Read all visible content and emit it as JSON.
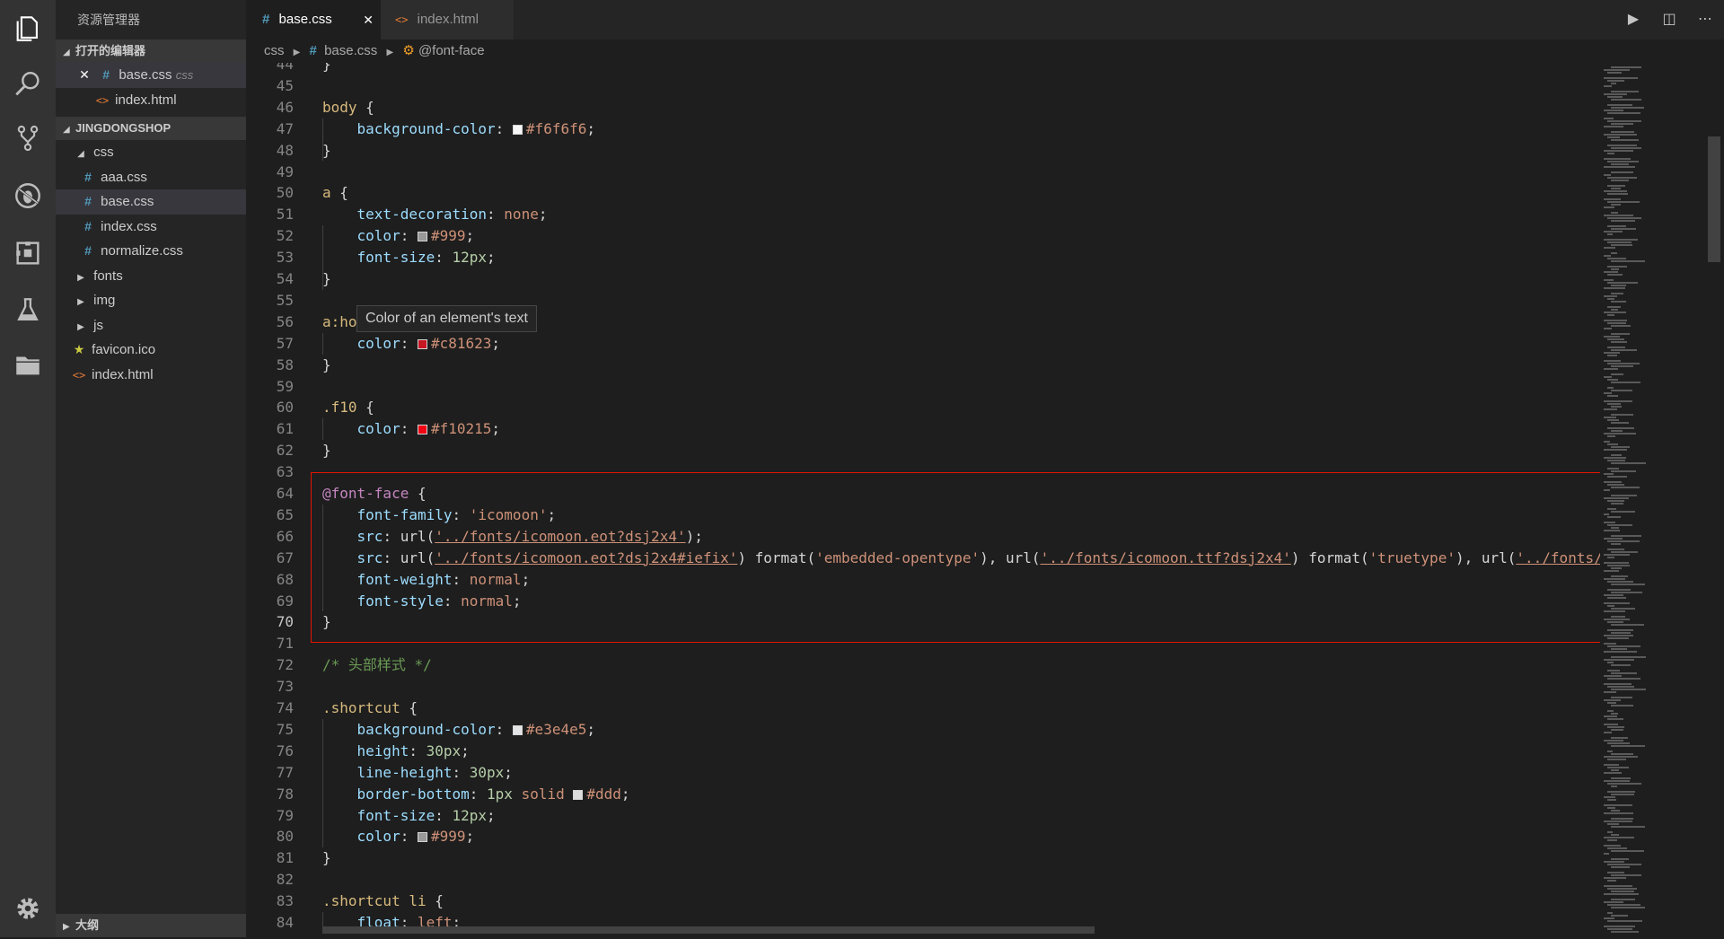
{
  "activity_bar": {
    "icons": [
      "files-icon",
      "search-icon",
      "source-control-icon",
      "debug-icon",
      "extensions-icon",
      "test-icon",
      "folder-icon",
      "settings-gear-icon"
    ]
  },
  "sidebar": {
    "title": "资源管理器",
    "open_editors": {
      "label": "打开的编辑器",
      "items": [
        {
          "name": "base.css",
          "hint": "css",
          "icon": "#"
        },
        {
          "name": "index.html",
          "hint": "",
          "icon": "<>"
        }
      ]
    },
    "project": {
      "label": "JINGDONGSHOP",
      "tree": [
        {
          "name": "css",
          "kind": "folder-open"
        },
        {
          "name": "aaa.css",
          "kind": "css"
        },
        {
          "name": "base.css",
          "kind": "css"
        },
        {
          "name": "index.css",
          "kind": "css"
        },
        {
          "name": "normalize.css",
          "kind": "css"
        },
        {
          "name": "fonts",
          "kind": "folder"
        },
        {
          "name": "img",
          "kind": "folder"
        },
        {
          "name": "js",
          "kind": "folder"
        },
        {
          "name": "favicon.ico",
          "kind": "ico"
        },
        {
          "name": "index.html",
          "kind": "html"
        }
      ]
    },
    "outline_label": "大纲"
  },
  "tabs": [
    {
      "label": "base.css",
      "icon": "#",
      "active": true,
      "close": "✕"
    },
    {
      "label": "index.html",
      "icon": "<>",
      "active": false
    }
  ],
  "breadcrumb": {
    "folder": "css",
    "file_icon": "#",
    "file": "base.css",
    "symbol": "@font-face"
  },
  "hover_tooltip": "Color of an element's text",
  "editor": {
    "current_line": 70,
    "lines": [
      {
        "n": 44,
        "tokens": [
          [
            "}",
            "punc"
          ]
        ]
      },
      {
        "n": 45,
        "tokens": []
      },
      {
        "n": 46,
        "tokens": [
          [
            "body",
            "sel"
          ],
          [
            " {",
            "punc"
          ]
        ]
      },
      {
        "n": 47,
        "tokens": [
          [
            "    background-color",
            "prop"
          ],
          [
            ": ",
            "punc"
          ],
          [
            "#f6f6f6",
            "val",
            "#f6f6f6"
          ],
          [
            ";",
            "punc"
          ]
        ]
      },
      {
        "n": 48,
        "tokens": [
          [
            "}",
            "punc"
          ]
        ]
      },
      {
        "n": 49,
        "tokens": []
      },
      {
        "n": 50,
        "tokens": [
          [
            "a",
            "sel"
          ],
          [
            " {",
            "punc"
          ]
        ]
      },
      {
        "n": 51,
        "tokens": [
          [
            "    text-decoration",
            "prop"
          ],
          [
            ": ",
            "punc"
          ],
          [
            "none",
            "val"
          ],
          [
            ";",
            "punc"
          ]
        ]
      },
      {
        "n": 52,
        "tokens": [
          [
            "    color",
            "prop"
          ],
          [
            ": ",
            "punc"
          ],
          [
            "#999",
            "val",
            "#999999"
          ],
          [
            ";",
            "punc"
          ]
        ]
      },
      {
        "n": 53,
        "tokens": [
          [
            "    font-size",
            "prop"
          ],
          [
            ": ",
            "punc"
          ],
          [
            "12px",
            "num"
          ],
          [
            ";",
            "punc"
          ]
        ]
      },
      {
        "n": 54,
        "tokens": [
          [
            "}",
            "punc"
          ]
        ]
      },
      {
        "n": 55,
        "tokens": []
      },
      {
        "n": 56,
        "tokens": [
          [
            "a:ho",
            "sel"
          ]
        ]
      },
      {
        "n": 57,
        "tokens": [
          [
            "    color",
            "prop"
          ],
          [
            ": ",
            "punc"
          ],
          [
            "#c81623",
            "val",
            "#c81623"
          ],
          [
            ";",
            "punc"
          ]
        ]
      },
      {
        "n": 58,
        "tokens": [
          [
            "}",
            "punc"
          ]
        ]
      },
      {
        "n": 59,
        "tokens": []
      },
      {
        "n": 60,
        "tokens": [
          [
            ".f10",
            "sel"
          ],
          [
            " {",
            "punc"
          ]
        ]
      },
      {
        "n": 61,
        "tokens": [
          [
            "    color",
            "prop"
          ],
          [
            ": ",
            "punc"
          ],
          [
            "#f10215",
            "val",
            "#f10215"
          ],
          [
            ";",
            "punc"
          ]
        ]
      },
      {
        "n": 62,
        "tokens": [
          [
            "}",
            "punc"
          ]
        ]
      },
      {
        "n": 63,
        "tokens": []
      },
      {
        "n": 64,
        "tokens": [
          [
            "@font-face",
            "at"
          ],
          [
            " {",
            "punc"
          ]
        ]
      },
      {
        "n": 65,
        "tokens": [
          [
            "    font-family",
            "prop"
          ],
          [
            ": ",
            "punc"
          ],
          [
            "'icomoon'",
            "val"
          ],
          [
            ";",
            "punc"
          ]
        ]
      },
      {
        "n": 66,
        "tokens": [
          [
            "    src",
            "prop"
          ],
          [
            ": url(",
            "punc"
          ],
          [
            "'../fonts/icomoon.eot?dsj2x4'",
            "url"
          ],
          [
            ");",
            "punc"
          ]
        ]
      },
      {
        "n": 67,
        "tokens": [
          [
            "    src",
            "prop"
          ],
          [
            ": url(",
            "punc"
          ],
          [
            "'../fonts/icomoon.eot?dsj2x4#iefix'",
            "url"
          ],
          [
            ") format(",
            "punc"
          ],
          [
            "'embedded-opentype'",
            "val"
          ],
          [
            "), url(",
            "punc"
          ],
          [
            "'../fonts/icomoon.ttf?dsj2x4'",
            "url"
          ],
          [
            ") format(",
            "punc"
          ],
          [
            "'truetype'",
            "val"
          ],
          [
            "), url(",
            "punc"
          ],
          [
            "'../fonts/",
            "url"
          ]
        ]
      },
      {
        "n": 68,
        "tokens": [
          [
            "    font-weight",
            "prop"
          ],
          [
            ": ",
            "punc"
          ],
          [
            "normal",
            "val"
          ],
          [
            ";",
            "punc"
          ]
        ]
      },
      {
        "n": 69,
        "tokens": [
          [
            "    font-style",
            "prop"
          ],
          [
            ": ",
            "punc"
          ],
          [
            "normal",
            "val"
          ],
          [
            ";",
            "punc"
          ]
        ]
      },
      {
        "n": 70,
        "tokens": [
          [
            "}",
            "punc"
          ]
        ]
      },
      {
        "n": 71,
        "tokens": []
      },
      {
        "n": 72,
        "tokens": [
          [
            "/* 头部样式 */",
            "com"
          ]
        ]
      },
      {
        "n": 73,
        "tokens": []
      },
      {
        "n": 74,
        "tokens": [
          [
            ".shortcut",
            "sel"
          ],
          [
            " {",
            "punc"
          ]
        ]
      },
      {
        "n": 75,
        "tokens": [
          [
            "    background-color",
            "prop"
          ],
          [
            ": ",
            "punc"
          ],
          [
            "#e3e4e5",
            "val",
            "#e3e4e5"
          ],
          [
            ";",
            "punc"
          ]
        ]
      },
      {
        "n": 76,
        "tokens": [
          [
            "    height",
            "prop"
          ],
          [
            ": ",
            "punc"
          ],
          [
            "30px",
            "num"
          ],
          [
            ";",
            "punc"
          ]
        ]
      },
      {
        "n": 77,
        "tokens": [
          [
            "    line-height",
            "prop"
          ],
          [
            ": ",
            "punc"
          ],
          [
            "30px",
            "num"
          ],
          [
            ";",
            "punc"
          ]
        ]
      },
      {
        "n": 78,
        "tokens": [
          [
            "    border-bottom",
            "prop"
          ],
          [
            ": ",
            "punc"
          ],
          [
            "1px",
            "num"
          ],
          [
            " solid ",
            "val"
          ],
          [
            "#ddd",
            "val",
            "#dddddd"
          ],
          [
            ";",
            "punc"
          ]
        ]
      },
      {
        "n": 79,
        "tokens": [
          [
            "    font-size",
            "prop"
          ],
          [
            ": ",
            "punc"
          ],
          [
            "12px",
            "num"
          ],
          [
            ";",
            "punc"
          ]
        ]
      },
      {
        "n": 80,
        "tokens": [
          [
            "    color",
            "prop"
          ],
          [
            ": ",
            "punc"
          ],
          [
            "#999",
            "val",
            "#999999"
          ],
          [
            ";",
            "punc"
          ]
        ]
      },
      {
        "n": 81,
        "tokens": [
          [
            "}",
            "punc"
          ]
        ]
      },
      {
        "n": 82,
        "tokens": []
      },
      {
        "n": 83,
        "tokens": [
          [
            ".shortcut li",
            "sel"
          ],
          [
            " {",
            "punc"
          ]
        ]
      },
      {
        "n": 84,
        "tokens": [
          [
            "    float",
            "prop"
          ],
          [
            ": ",
            "punc"
          ],
          [
            "left",
            "val"
          ],
          [
            ";",
            "punc"
          ]
        ]
      }
    ]
  },
  "colors": {
    "activity_bar": "#333333",
    "sidebar": "#252526",
    "editor_bg": "#1e1e1e",
    "highlight_border": "#e51400"
  }
}
